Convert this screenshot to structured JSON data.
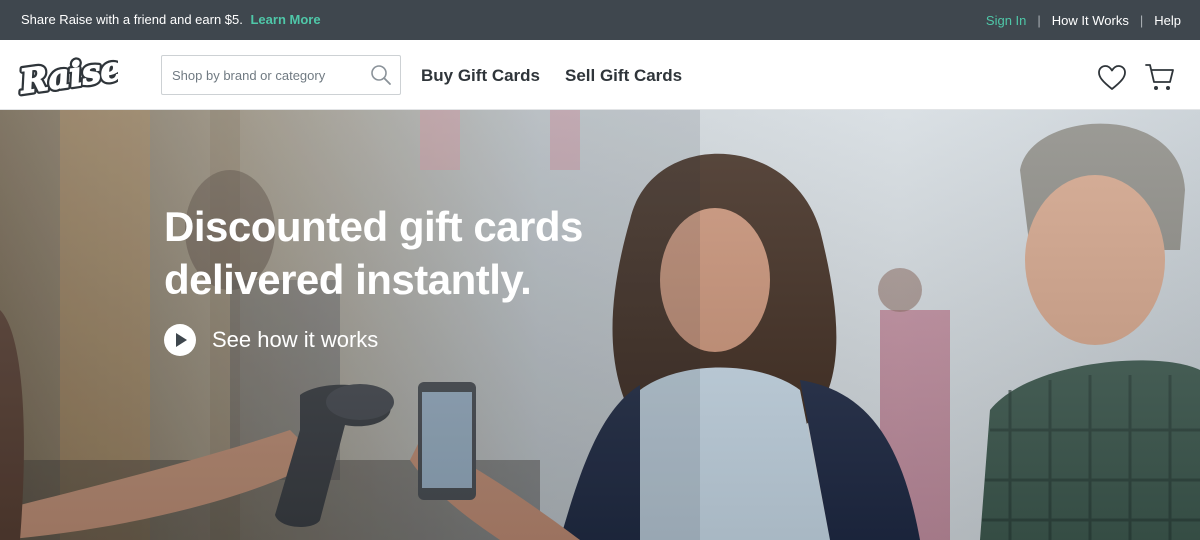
{
  "topbar": {
    "promo_text": "Share Raise with a friend and earn $5.",
    "learn_more": "Learn More",
    "sign_in": "Sign In",
    "how_it_works": "How It Works",
    "help": "Help",
    "separator": "|"
  },
  "header": {
    "logo_text": "Raise",
    "search_placeholder": "Shop by brand or category",
    "nav": {
      "buy": "Buy Gift Cards",
      "sell": "Sell Gift Cards"
    },
    "icons": {
      "search": "search-icon",
      "favorites": "heart-icon",
      "cart": "cart-icon"
    }
  },
  "hero": {
    "headline_line1": "Discounted gift cards",
    "headline_line2": "delivered instantly.",
    "cta_label": "See how it works",
    "cta_icon": "play-icon"
  },
  "colors": {
    "topbar_bg": "#3f474e",
    "accent": "#4fc7a8",
    "nav_text": "#2f353a"
  }
}
